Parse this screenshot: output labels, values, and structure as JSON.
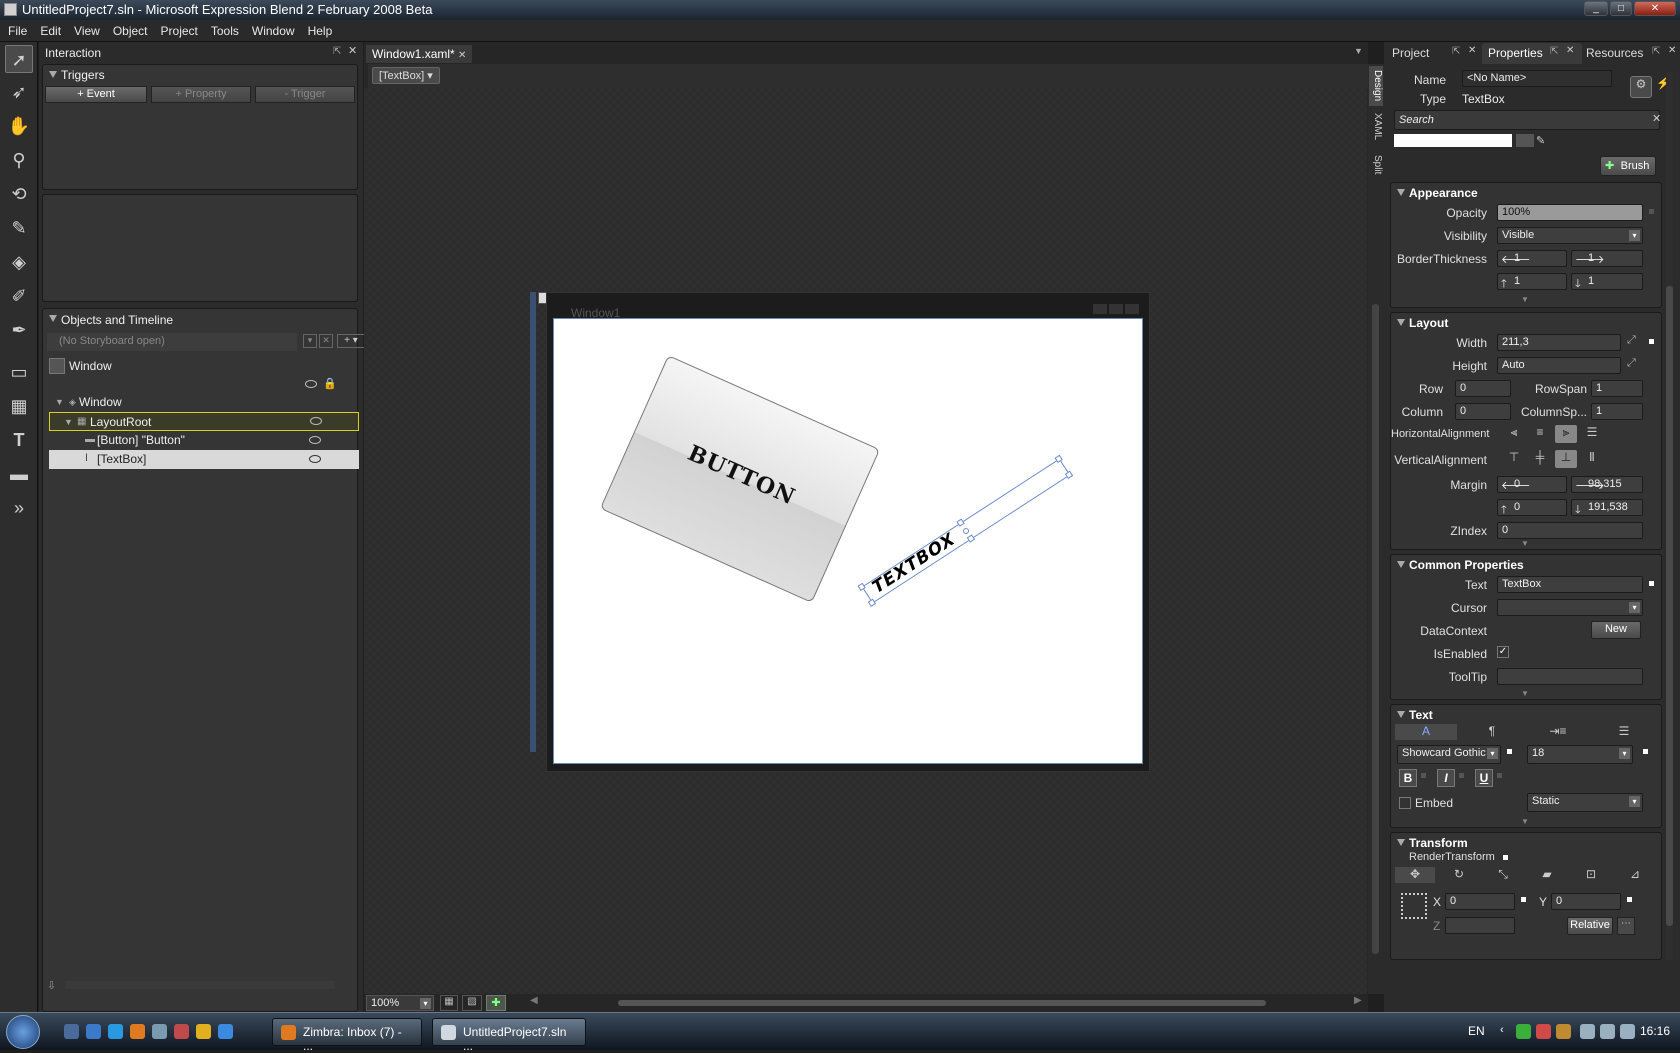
{
  "window": {
    "title": "UntitledProject7.sln - Microsoft Expression Blend 2 February 2008 Beta"
  },
  "menu": [
    "File",
    "Edit",
    "View",
    "Object",
    "Project",
    "Tools",
    "Window",
    "Help"
  ],
  "toolbox": [
    "selection-icon",
    "direct-selection-icon",
    "pan-icon",
    "zoom-icon",
    "camera-orbit-icon",
    "eyedropper-icon",
    "paint-bucket-icon",
    "brush-transform-icon",
    "pen-icon",
    "rectangle-icon",
    "grid-icon",
    "text-icon",
    "asset-button-icon",
    "more-icon"
  ],
  "interaction": {
    "header": "Interaction",
    "triggers": "Triggers",
    "event_btn": "+ Event",
    "property_btn": "+ Property",
    "trigger_btn": "- Trigger"
  },
  "objects": {
    "header": "Objects and Timeline",
    "storyboard": "(No Storyboard open)",
    "scope": "Window",
    "tree": [
      "Window",
      "LayoutRoot",
      "[Button] \"Button\"",
      "[TextBox]"
    ]
  },
  "document": {
    "tab": "Window1.xaml*",
    "breadcrumb": "[TextBox]",
    "zoom": "100%",
    "side_tabs": [
      "Design",
      "XAML",
      "Split"
    ],
    "artboard_title": "Window1",
    "button_text": "BUTTON",
    "textbox_text": "TEXTBOX"
  },
  "right_tabs": [
    "Project",
    "Properties",
    "Resources"
  ],
  "properties": {
    "name_label": "Name",
    "name_value": "<No Name>",
    "type_label": "Type",
    "type_value": "TextBox",
    "search_placeholder": "Search",
    "brush_btn": "Brush",
    "appearance": {
      "title": "Appearance",
      "opacity_label": "Opacity",
      "opacity": "100%",
      "visibility_label": "Visibility",
      "visibility": "Visible",
      "border_label": "BorderThickness",
      "border": [
        "1",
        "1",
        "1",
        "1"
      ]
    },
    "layout": {
      "title": "Layout",
      "width_label": "Width",
      "width": "211,3",
      "height_label": "Height",
      "height": "Auto",
      "row_label": "Row",
      "row": "0",
      "rowspan_label": "RowSpan",
      "rowspan": "1",
      "column_label": "Column",
      "column": "0",
      "colspan_label": "ColumnSp...",
      "colspan": "1",
      "halign_label": "HorizontalAlignment",
      "valign_label": "VerticalAlignment",
      "margin_label": "Margin",
      "margin": [
        "0",
        "98,315",
        "0",
        "191,538"
      ],
      "zindex_label": "ZIndex",
      "zindex": "0"
    },
    "common": {
      "title": "Common Properties",
      "text_label": "Text",
      "text": "TextBox",
      "cursor_label": "Cursor",
      "datacontext_label": "DataContext",
      "new_btn": "New",
      "isenabled_label": "IsEnabled",
      "tooltip_label": "ToolTip"
    },
    "text": {
      "title": "Text",
      "font": "Showcard Gothic",
      "size": "18",
      "bold": "B",
      "italic": "I",
      "underline": "U",
      "embed_label": "Embed",
      "mode": "Static"
    },
    "transform": {
      "title": "Transform",
      "render_label": "RenderTransform",
      "x_label": "X",
      "x": "0",
      "y_label": "Y",
      "y": "0",
      "z_label": "Z",
      "relative_btn": "Relative"
    }
  },
  "taskbar": {
    "items": [
      "Zimbra: Inbox (7) - ...",
      "UntitledProject7.sln ..."
    ],
    "lang": "EN",
    "time": "16:16"
  }
}
